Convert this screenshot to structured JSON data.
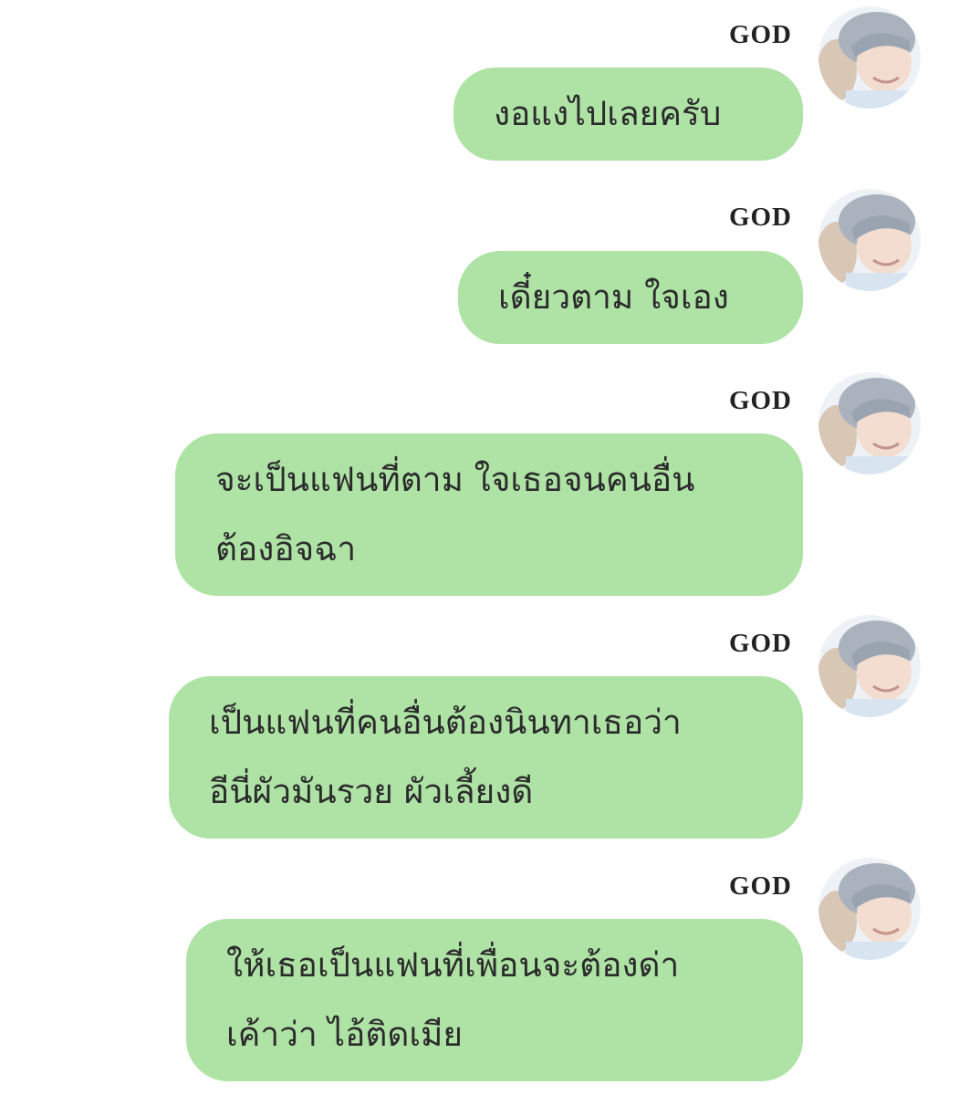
{
  "colors": {
    "bubble": "#afe3a6",
    "text": "#2b2b2b",
    "sender": "#222222",
    "background": "#ffffff"
  },
  "messages": [
    {
      "sender": "GOD",
      "avatar_icon": "user-avatar-photo",
      "text": "งอแงไปเลยครับ"
    },
    {
      "sender": "GOD",
      "avatar_icon": "user-avatar-photo",
      "text": "เดี๋ยวตาม ใจเอง"
    },
    {
      "sender": "GOD",
      "avatar_icon": "user-avatar-photo",
      "text": "จะเป็นแฟนที่ตาม ใจเธอจนคนอื่น\nต้องอิจฉา"
    },
    {
      "sender": "GOD",
      "avatar_icon": "user-avatar-photo",
      "text": "เป็นแฟนที่คนอื่นต้องนินทาเธอว่า\nอีนี่ผัวมันรวย ผัวเลี้ยงดี"
    },
    {
      "sender": "GOD",
      "avatar_icon": "user-avatar-photo",
      "text": "ให้เธอเป็นแฟนที่เพื่อนจะต้องด่า\nเค้าว่า ไอ้ติดเมีย"
    }
  ]
}
